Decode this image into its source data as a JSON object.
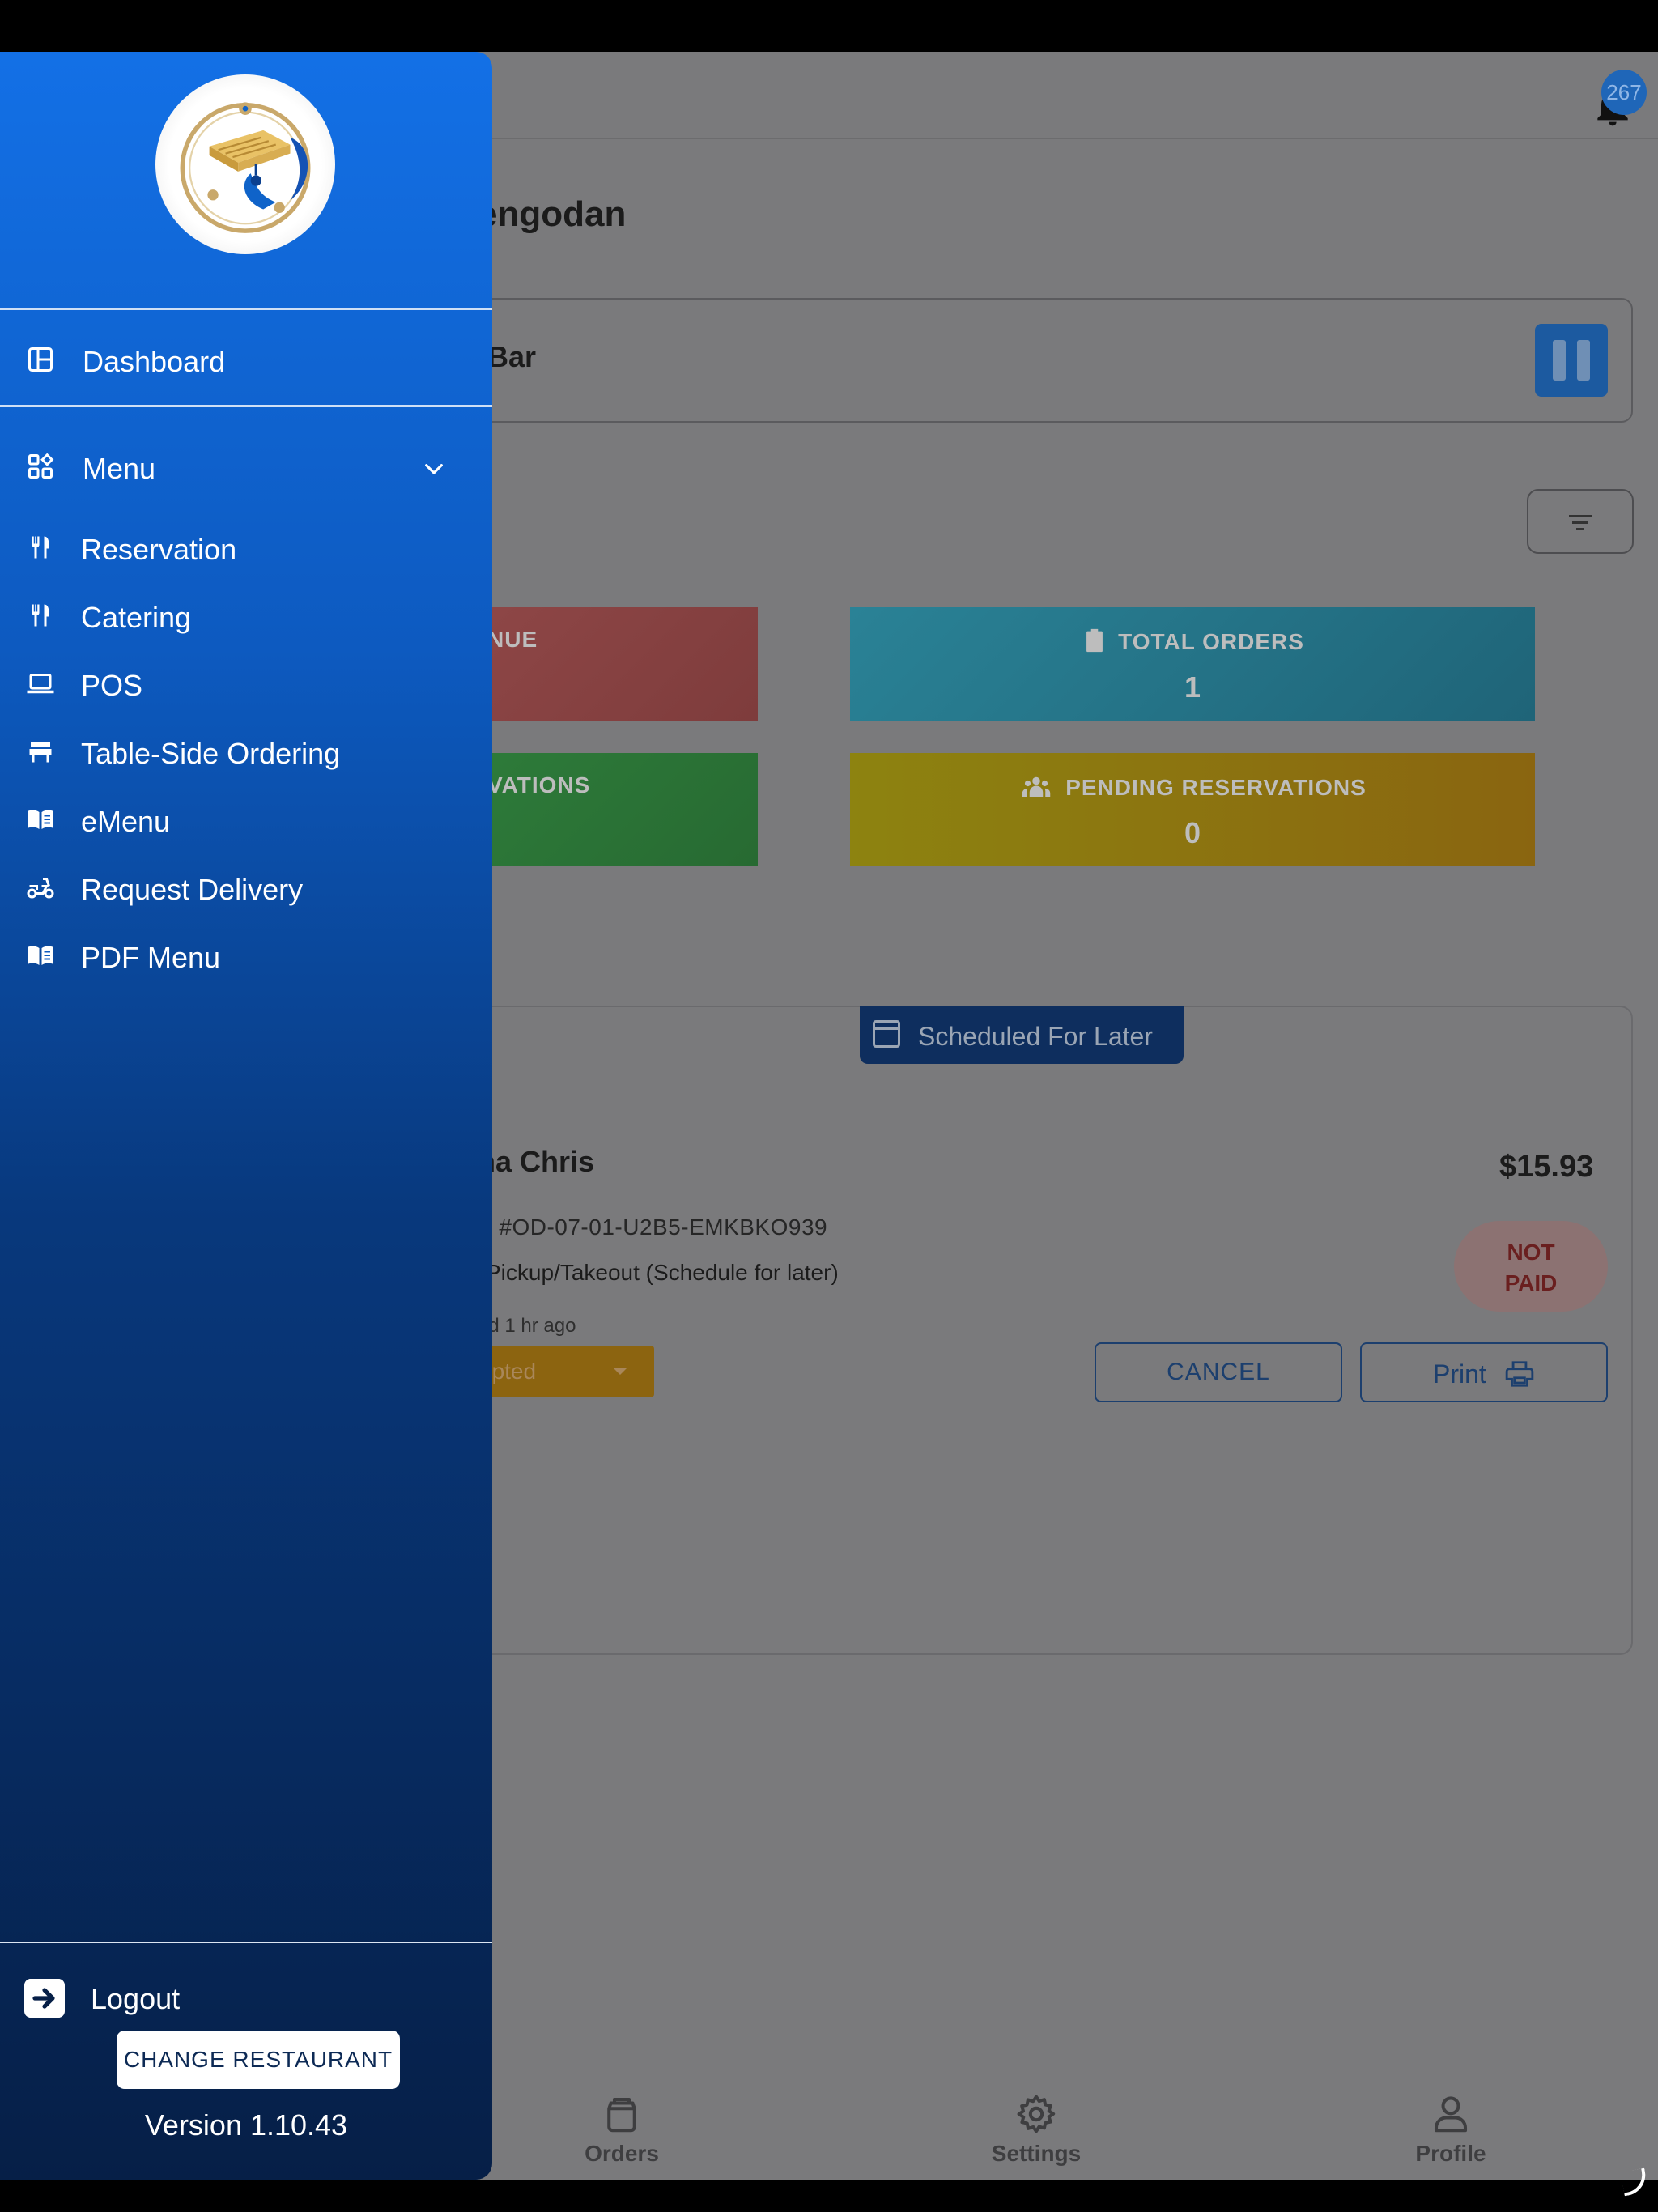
{
  "header": {
    "notification_count": "267"
  },
  "welcome": {
    "text": "engodan"
  },
  "status_card": {
    "restaurant_name": "Bar"
  },
  "stats": {
    "revenue_label": "NUE",
    "total_orders_label": "TOTAL ORDERS",
    "total_orders_value": "1",
    "reservations_label": "VATIONS",
    "pending_reservations_label": "PENDING RESERVATIONS",
    "pending_reservations_value": "0"
  },
  "order": {
    "badge": "Scheduled For Later",
    "customer": "na Chris",
    "total": "$15.93",
    "id": "r: #OD-07-01-U2B5-EMKBKO939",
    "type": "Pickup/Takeout (Schedule for later)",
    "time": "ed 1 hr ago",
    "payment_status_line1": "NOT",
    "payment_status_line2": "PAID",
    "status": "epted",
    "cancel_label": "CANCEL",
    "print_label": "Print"
  },
  "bottom_nav": {
    "orders": "Orders",
    "settings": "Settings",
    "profile": "Profile"
  },
  "drawer": {
    "dashboard": "Dashboard",
    "menu": "Menu",
    "items": [
      {
        "label": "Reservation",
        "icon": "fork-knife-icon"
      },
      {
        "label": "Catering",
        "icon": "fork-knife-icon"
      },
      {
        "label": "POS",
        "icon": "laptop-icon"
      },
      {
        "label": "Table-Side Ordering",
        "icon": "table-icon"
      },
      {
        "label": "eMenu",
        "icon": "menu-book-icon"
      },
      {
        "label": "Request Delivery",
        "icon": "scooter-icon"
      },
      {
        "label": "PDF Menu",
        "icon": "menu-book-icon"
      }
    ],
    "logout": "Logout",
    "change_restaurant": "CHANGE RESTAURANT",
    "version": "Version 1.10.43"
  },
  "colors": {
    "drawer_top": "#1370e6",
    "drawer_bottom": "#061f47",
    "accent": "#1c5aa0"
  }
}
